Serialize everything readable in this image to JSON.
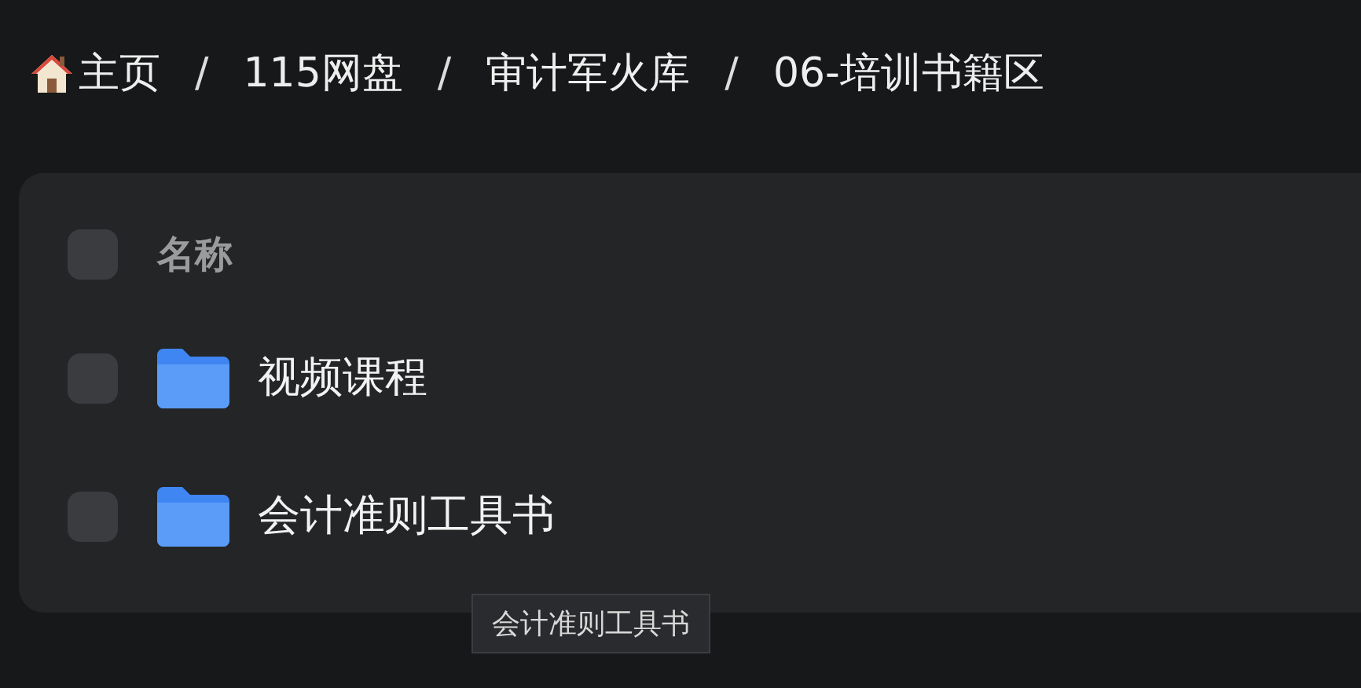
{
  "breadcrumb": [
    {
      "label": "主页",
      "kind": "home"
    },
    {
      "label": "115网盘",
      "kind": "crumb"
    },
    {
      "label": "审计军火库",
      "kind": "crumb"
    },
    {
      "label": "06-培训书籍区",
      "kind": "crumb"
    }
  ],
  "breadcrumb_separator": "/",
  "table": {
    "header": {
      "label": "名称",
      "checked": false
    },
    "rows": [
      {
        "name": "视频课程",
        "checked": false
      },
      {
        "name": "会计准则工具书",
        "checked": false
      }
    ]
  },
  "tooltip": {
    "text": "会计准则工具书"
  }
}
